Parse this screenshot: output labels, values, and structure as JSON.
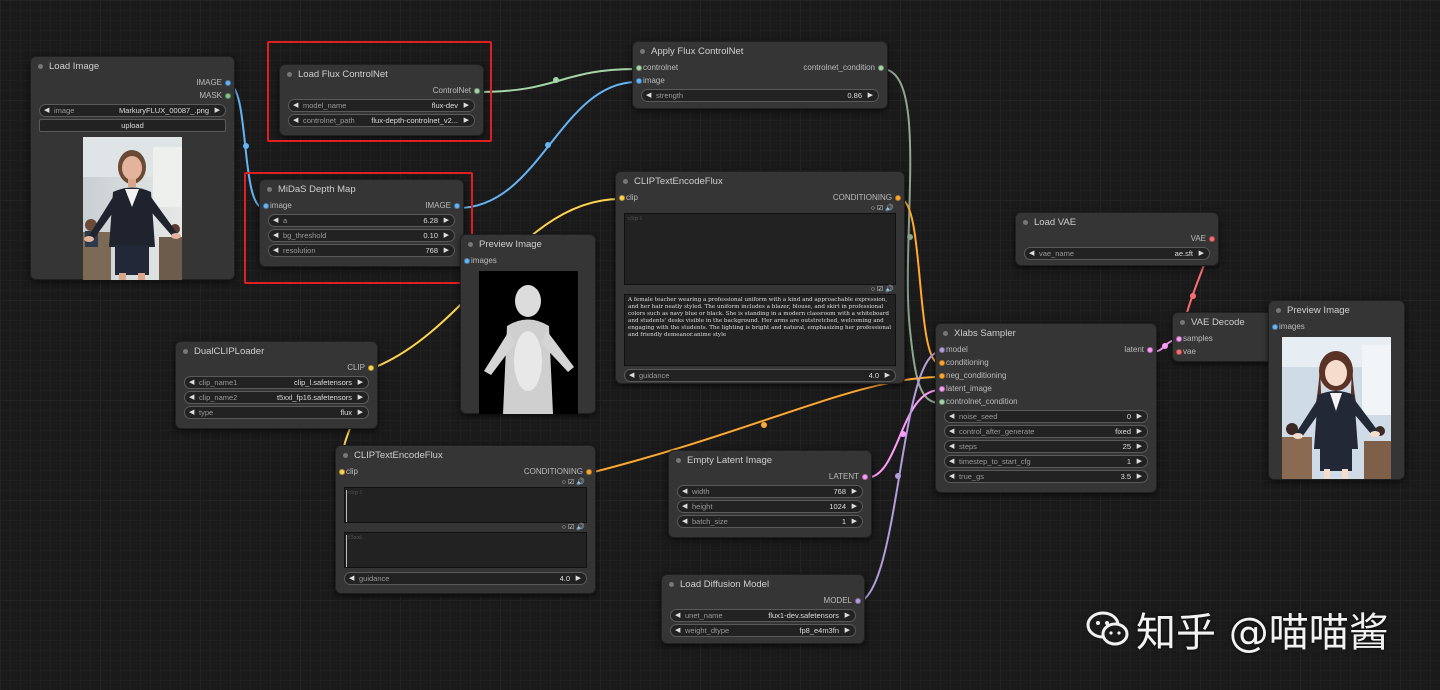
{
  "colors": {
    "image": "#64b5f6",
    "mask": "#81c784",
    "controlnet": "#a5d6a7",
    "clip": "#ffd54f",
    "conditioning": "#ffa931",
    "latent": "#ff9cf9",
    "model": "#b39ddb",
    "vae": "#ff6e6e",
    "highlight": "#e02020"
  },
  "load_image": {
    "title": "Load Image",
    "outputs": [
      "IMAGE",
      "MASK"
    ],
    "widgets": [
      {
        "name": "image",
        "value": "MarkuryFLUX_00087_.png"
      }
    ],
    "upload_label": "upload"
  },
  "load_flux_controlnet": {
    "title": "Load Flux ControlNet",
    "output": "ControlNet",
    "widgets": [
      {
        "name": "model_name",
        "value": "flux-dev"
      },
      {
        "name": "controlnet_path",
        "value": "flux-depth-controlnet_v2..."
      }
    ]
  },
  "apply_flux_controlnet": {
    "title": "Apply Flux ControlNet",
    "inputs": [
      "controlnet",
      "image"
    ],
    "output": "controlnet_condition",
    "widgets": [
      {
        "name": "strength",
        "value": "0.86"
      }
    ]
  },
  "midas": {
    "title": "MiDaS Depth Map",
    "input": "image",
    "output": "IMAGE",
    "widgets": [
      {
        "name": "a",
        "value": "6.28"
      },
      {
        "name": "bg_threshold",
        "value": "0.10"
      },
      {
        "name": "resolution",
        "value": "768"
      }
    ]
  },
  "preview_depth": {
    "title": "Preview Image",
    "input": "images"
  },
  "clip_text_pos": {
    "title": "CLIPTextEncodeFlux",
    "input": "clip",
    "output": "CONDITIONING",
    "clip_l_placeholder": "clip l",
    "t5xxl_text": "A female teacher wearing a professional uniform with a kind and approachable expression, and her hair neatly styled. The uniform includes a blazer, blouse, and skirt in professional colors such as navy blue or black. She is standing in a modern classroom with a whiteboard and students' desks visible in the background. Her arms are outstretched, welcoming and engaging with the students. The lighting is bright and natural, emphasizing her professional and friendly demeanor.anime style",
    "widgets": [
      {
        "name": "guidance",
        "value": "4.0"
      }
    ]
  },
  "load_vae": {
    "title": "Load VAE",
    "output": "VAE",
    "widgets": [
      {
        "name": "vae_name",
        "value": "ae.sft"
      }
    ]
  },
  "vae_decode": {
    "title": "VAE Decode",
    "inputs": [
      "samples",
      "vae"
    ]
  },
  "preview_final": {
    "title": "Preview Image",
    "input": "images"
  },
  "xlabs_sampler": {
    "title": "Xlabs Sampler",
    "inputs": [
      "model",
      "conditioning",
      "neg_conditioning",
      "latent_image",
      "controlnet_condition"
    ],
    "output": "latent",
    "widgets": [
      {
        "name": "noise_seed",
        "value": "0"
      },
      {
        "name": "control_after_generate",
        "value": "fixed"
      },
      {
        "name": "steps",
        "value": "25"
      },
      {
        "name": "timestep_to_start_cfg",
        "value": "1"
      },
      {
        "name": "true_gs",
        "value": "3.5"
      }
    ]
  },
  "dual_clip": {
    "title": "DualCLIPLoader",
    "output": "CLIP",
    "widgets": [
      {
        "name": "clip_name1",
        "value": "clip_l.safetensors"
      },
      {
        "name": "clip_name2",
        "value": "t5xxl_fp16.safetensors"
      },
      {
        "name": "type",
        "value": "flux"
      }
    ]
  },
  "clip_text_neg": {
    "title": "CLIPTextEncodeFlux",
    "input": "clip",
    "output": "CONDITIONING",
    "clip_l_placeholder": "clip l",
    "t5xxl_placeholder": "t5xxl",
    "widgets": [
      {
        "name": "guidance",
        "value": "4.0"
      }
    ]
  },
  "empty_latent": {
    "title": "Empty Latent Image",
    "output": "LATENT",
    "widgets": [
      {
        "name": "width",
        "value": "768"
      },
      {
        "name": "height",
        "value": "1024"
      },
      {
        "name": "batch_size",
        "value": "1"
      }
    ]
  },
  "load_diffusion": {
    "title": "Load Diffusion Model",
    "output": "MODEL",
    "widgets": [
      {
        "name": "unet_name",
        "value": "flux1-dev.safetensors"
      },
      {
        "name": "weight_dtype",
        "value": "fp8_e4m3fn"
      }
    ]
  },
  "watermark": {
    "text": "知乎 @喵喵酱"
  }
}
